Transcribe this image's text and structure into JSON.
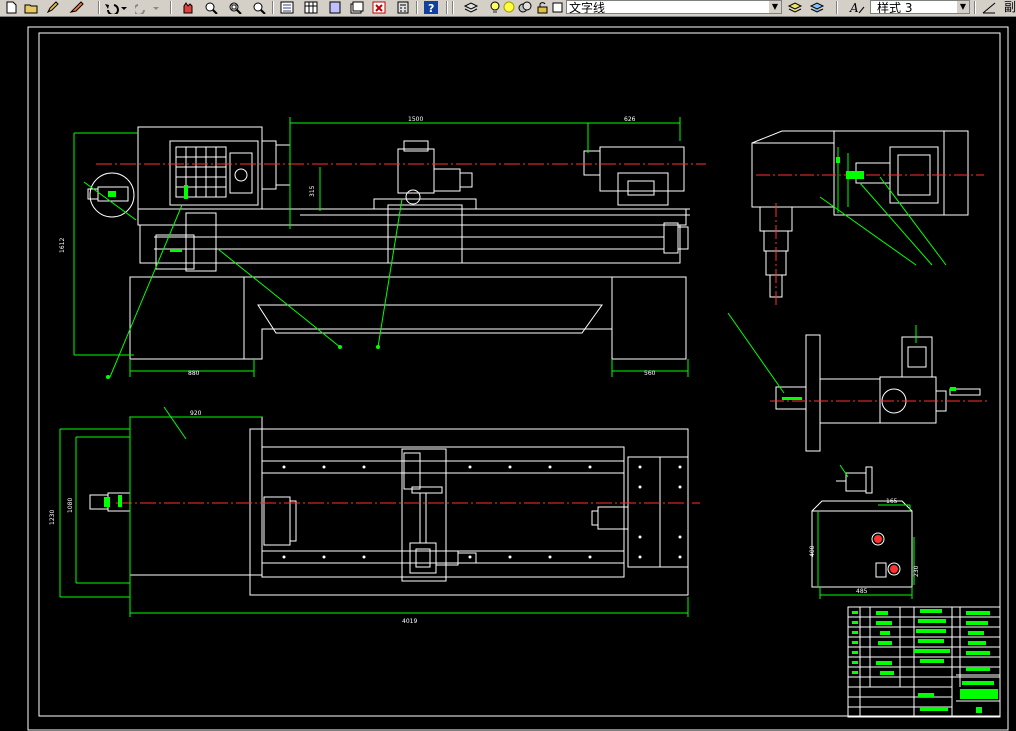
{
  "toolbar": {
    "layer_name": "文字线",
    "text_style": "样式 3",
    "right_cut_label": "副",
    "colors": {
      "bg": "#d4d0c8",
      "canvas": "#000000",
      "lines": "#ffffff",
      "dimensions": "#00ff00",
      "centerline": "#ff0000",
      "titleblock_fill": "#00ff00"
    }
  },
  "drawing": {
    "dims": {
      "top_length": "1500",
      "top_right": "626",
      "height_left": "1612",
      "height_small": "315",
      "bottom_left_width": "880",
      "bottom_right_width": "560",
      "plan_small": "920",
      "plan_height_outer": "1230",
      "plan_height_inner": "1080",
      "plan_total": "4019",
      "detail_width": "165",
      "detail_height": "400",
      "detail_bottom": "485",
      "detail_small": "230"
    }
  }
}
